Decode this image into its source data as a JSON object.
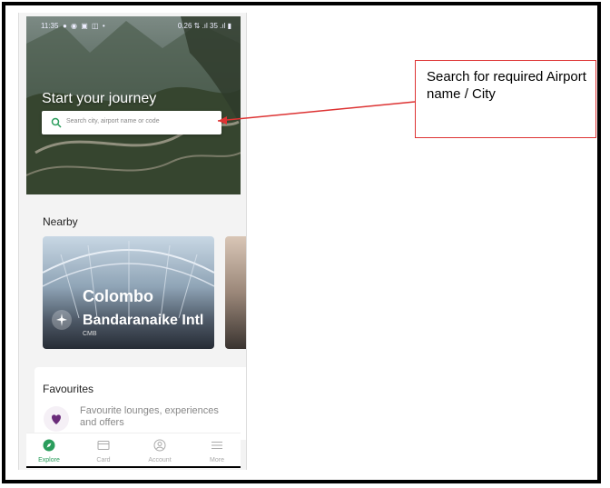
{
  "status_bar": {
    "time": "11:35",
    "right": "0.26 ⇅ .ıl 35 .ıl ▮"
  },
  "hero": {
    "title": "Start your journey",
    "search_placeholder": "Search city, airport name or code"
  },
  "nearby": {
    "label": "Nearby",
    "card": {
      "city": "Colombo",
      "airport": "Bandaranaike Intl",
      "code": "CMB"
    }
  },
  "favourites": {
    "label": "Favourites",
    "text": "Favourite lounges, experiences and offers"
  },
  "bottom_nav": [
    {
      "label": "Explore",
      "icon": "compass-icon",
      "active": true
    },
    {
      "label": "Card",
      "icon": "card-icon",
      "active": false
    },
    {
      "label": "Account",
      "icon": "account-icon",
      "active": false
    },
    {
      "label": "More",
      "icon": "menu-icon",
      "active": false
    }
  ],
  "annotation": {
    "text": "Search for required Airport name / City"
  },
  "colors": {
    "accent": "#2a9d5c",
    "annotation": "#d33333",
    "heart": "#6a2c7a"
  }
}
